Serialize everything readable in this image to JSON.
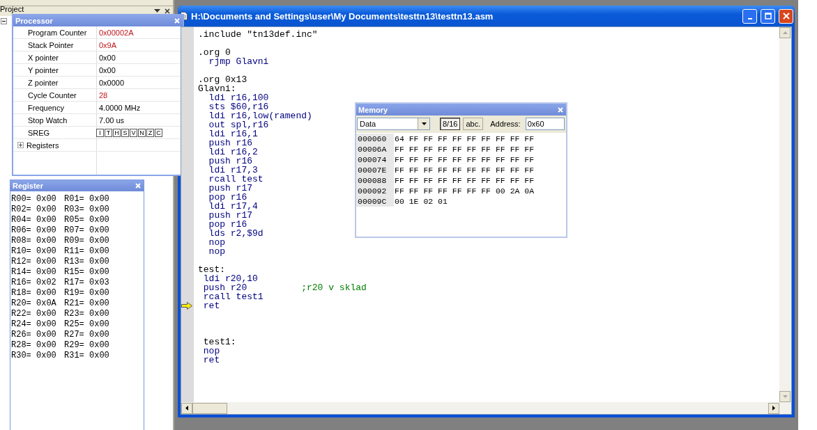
{
  "project_panel": {
    "title": "Project"
  },
  "processor": {
    "title": "Processor",
    "rows": [
      {
        "kind": "value",
        "label": "Program Counter",
        "value": "0x00002A",
        "changed": true
      },
      {
        "kind": "value",
        "label": "Stack Pointer",
        "value": "0x9A",
        "changed": true
      },
      {
        "kind": "value",
        "label": "X pointer",
        "value": "0x00",
        "changed": false
      },
      {
        "kind": "value",
        "label": "Y pointer",
        "value": "0x00",
        "changed": false
      },
      {
        "kind": "value",
        "label": "Z pointer",
        "value": "0x0000",
        "changed": false
      },
      {
        "kind": "value",
        "label": "Cycle Counter",
        "value": "28",
        "changed": true
      },
      {
        "kind": "value",
        "label": "Frequency",
        "value": "4.0000 MHz",
        "changed": false
      },
      {
        "kind": "value",
        "label": "Stop Watch",
        "value": "7.00 us",
        "changed": false
      },
      {
        "kind": "flags",
        "label": "SREG",
        "flags": [
          "I",
          "T",
          "H",
          "S",
          "V",
          "N",
          "Z",
          "C"
        ]
      },
      {
        "kind": "group",
        "label": "Registers",
        "expanded": false
      }
    ]
  },
  "register_window": {
    "title": "Register",
    "registers": [
      {
        "name": "R00=",
        "value": "0x00"
      },
      {
        "name": "R01=",
        "value": "0x00"
      },
      {
        "name": "R02=",
        "value": "0x00"
      },
      {
        "name": "R03=",
        "value": "0x00"
      },
      {
        "name": "R04=",
        "value": "0x00"
      },
      {
        "name": "R05=",
        "value": "0x00"
      },
      {
        "name": "R06=",
        "value": "0x00"
      },
      {
        "name": "R07=",
        "value": "0x00"
      },
      {
        "name": "R08=",
        "value": "0x00"
      },
      {
        "name": "R09=",
        "value": "0x00"
      },
      {
        "name": "R10=",
        "value": "0x00"
      },
      {
        "name": "R11=",
        "value": "0x00"
      },
      {
        "name": "R12=",
        "value": "0x00"
      },
      {
        "name": "R13=",
        "value": "0x00"
      },
      {
        "name": "R14=",
        "value": "0x00"
      },
      {
        "name": "R15=",
        "value": "0x00"
      },
      {
        "name": "R16=",
        "value": "0x02"
      },
      {
        "name": "R17=",
        "value": "0x03"
      },
      {
        "name": "R18=",
        "value": "0x00"
      },
      {
        "name": "R19=",
        "value": "0x00"
      },
      {
        "name": "R20=",
        "value": "0x0A"
      },
      {
        "name": "R21=",
        "value": "0x00"
      },
      {
        "name": "R22=",
        "value": "0x00"
      },
      {
        "name": "R23=",
        "value": "0x00"
      },
      {
        "name": "R24=",
        "value": "0x00"
      },
      {
        "name": "R25=",
        "value": "0x00"
      },
      {
        "name": "R26=",
        "value": "0x00"
      },
      {
        "name": "R27=",
        "value": "0x00"
      },
      {
        "name": "R28=",
        "value": "0x00"
      },
      {
        "name": "R29=",
        "value": "0x00"
      },
      {
        "name": "R30=",
        "value": "0x00"
      },
      {
        "name": "R31=",
        "value": "0x00"
      }
    ]
  },
  "editor": {
    "title": "H:\\Documents and Settings\\user\\My Documents\\testtn13\\testtn13.asm",
    "lines": [
      {
        "kind": "directive",
        "text": ".include \"tn13def.inc\"",
        "current": false
      },
      {
        "kind": "blank",
        "current": false
      },
      {
        "kind": "directive",
        "text": ".org 0",
        "current": false
      },
      {
        "kind": "instruction",
        "text": "  rjmp Glavni",
        "current": false
      },
      {
        "kind": "blank",
        "current": false
      },
      {
        "kind": "directive",
        "text": ".org 0x13",
        "current": false
      },
      {
        "kind": "label",
        "text": "Glavni:",
        "current": false
      },
      {
        "kind": "instruction",
        "text": "  ldi r16,100",
        "current": false
      },
      {
        "kind": "instruction",
        "text": "  sts $60,r16",
        "current": false
      },
      {
        "kind": "instruction",
        "text": "  ldi r16,low(ramend)",
        "current": false
      },
      {
        "kind": "instruction",
        "text": "  out spl,r16",
        "current": false
      },
      {
        "kind": "instruction",
        "text": "  ldi r16,1",
        "current": false
      },
      {
        "kind": "instruction",
        "text": "  push r16",
        "current": false
      },
      {
        "kind": "instruction",
        "text": "  ldi r16,2",
        "current": false
      },
      {
        "kind": "instruction",
        "text": "  push r16",
        "current": false
      },
      {
        "kind": "instruction",
        "text": "  ldi r17,3",
        "current": false
      },
      {
        "kind": "instruction",
        "text": "  rcall test",
        "current": false
      },
      {
        "kind": "instruction",
        "text": "  push r17",
        "current": false
      },
      {
        "kind": "instruction",
        "text": "  pop r16",
        "current": false
      },
      {
        "kind": "instruction",
        "text": "  ldi r17,4",
        "current": false
      },
      {
        "kind": "instruction",
        "text": "  push r17",
        "current": false
      },
      {
        "kind": "instruction",
        "text": "  pop r16",
        "current": false
      },
      {
        "kind": "instruction",
        "text": "  lds r2,$9d",
        "current": false
      },
      {
        "kind": "instruction",
        "text": "  nop",
        "current": false
      },
      {
        "kind": "instruction",
        "text": "  nop",
        "current": false
      },
      {
        "kind": "blank",
        "current": false
      },
      {
        "kind": "label",
        "text": "test:",
        "current": false
      },
      {
        "kind": "instruction",
        "text": " ldi r20,10",
        "current": false
      },
      {
        "kind": "instruction",
        "text": " push r20",
        "comment": ";r20 v sklad",
        "current": false
      },
      {
        "kind": "instruction",
        "text": " rcall test1",
        "current": false
      },
      {
        "kind": "instruction",
        "text": " ret",
        "current": true
      },
      {
        "kind": "blank",
        "current": false
      },
      {
        "kind": "blank",
        "current": false
      },
      {
        "kind": "blank",
        "current": false
      },
      {
        "kind": "label",
        "text": " test1:",
        "current": false
      },
      {
        "kind": "instruction",
        "text": " nop",
        "current": false
      },
      {
        "kind": "instruction",
        "text": " ret",
        "current": false
      }
    ]
  },
  "memory": {
    "title": "Memory",
    "space": "Data",
    "word_button": {
      "label": "8/16",
      "pressed": true
    },
    "ascii_button": {
      "label": "abc.",
      "pressed": false
    },
    "address_label": "Address:",
    "address": "0x60",
    "rows": [
      {
        "address": "000060",
        "bytes": "64 FF FF FF FF FF FF FF FF FF"
      },
      {
        "address": "00006A",
        "bytes": "FF FF FF FF FF FF FF FF FF FF"
      },
      {
        "address": "000074",
        "bytes": "FF FF FF FF FF FF FF FF FF FF"
      },
      {
        "address": "00007E",
        "bytes": "FF FF FF FF FF FF FF FF FF FF"
      },
      {
        "address": "000088",
        "bytes": "FF FF FF FF FF FF FF FF FF FF"
      },
      {
        "address": "000092",
        "bytes": "FF FF FF FF FF FF FF 00 2A 0A"
      },
      {
        "address": "00009C",
        "bytes": "00 1E 02 01"
      }
    ]
  }
}
